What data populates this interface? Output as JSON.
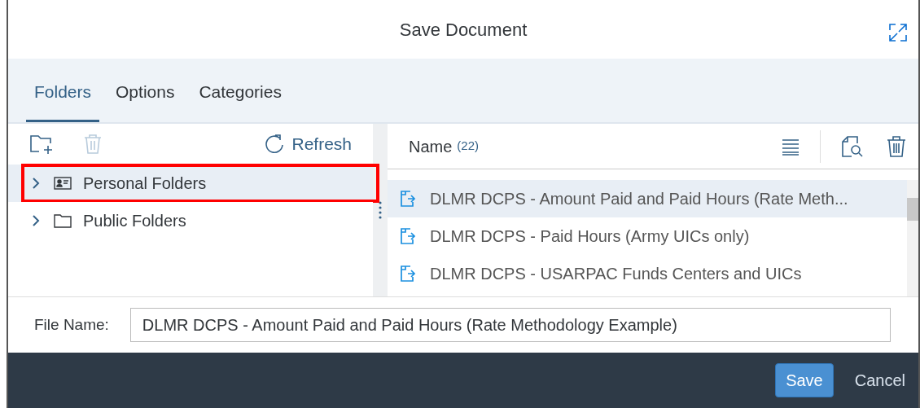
{
  "dialog": {
    "title": "Save Document"
  },
  "tabs": [
    {
      "label": "Folders",
      "selected": true
    },
    {
      "label": "Options",
      "selected": false
    },
    {
      "label": "Categories",
      "selected": false
    }
  ],
  "folder_toolbar": {
    "refresh": "Refresh"
  },
  "folders": [
    {
      "label": "Personal Folders",
      "kind": "personal",
      "selected": true,
      "expanded": false,
      "highlighted": true
    },
    {
      "label": "Public Folders",
      "kind": "public",
      "selected": false,
      "expanded": false,
      "highlighted": false
    }
  ],
  "list_header": {
    "title": "Name",
    "count": "(22)"
  },
  "documents": [
    {
      "name": "DLMR DCPS - Amount Paid and Paid Hours (Rate Meth...",
      "selected": true
    },
    {
      "name": "DLMR DCPS - Paid Hours (Army UICs only)",
      "selected": false
    },
    {
      "name": "DLMR DCPS - USARPAC Funds Centers and UICs",
      "selected": false
    }
  ],
  "file_name": {
    "label": "File Name:",
    "value": "DLMR DCPS - Amount Paid and Paid Hours (Rate Methodology Example)"
  },
  "buttons": [
    {
      "label": "Save",
      "kind": "primary"
    },
    {
      "label": "Cancel",
      "kind": "plain"
    }
  ]
}
